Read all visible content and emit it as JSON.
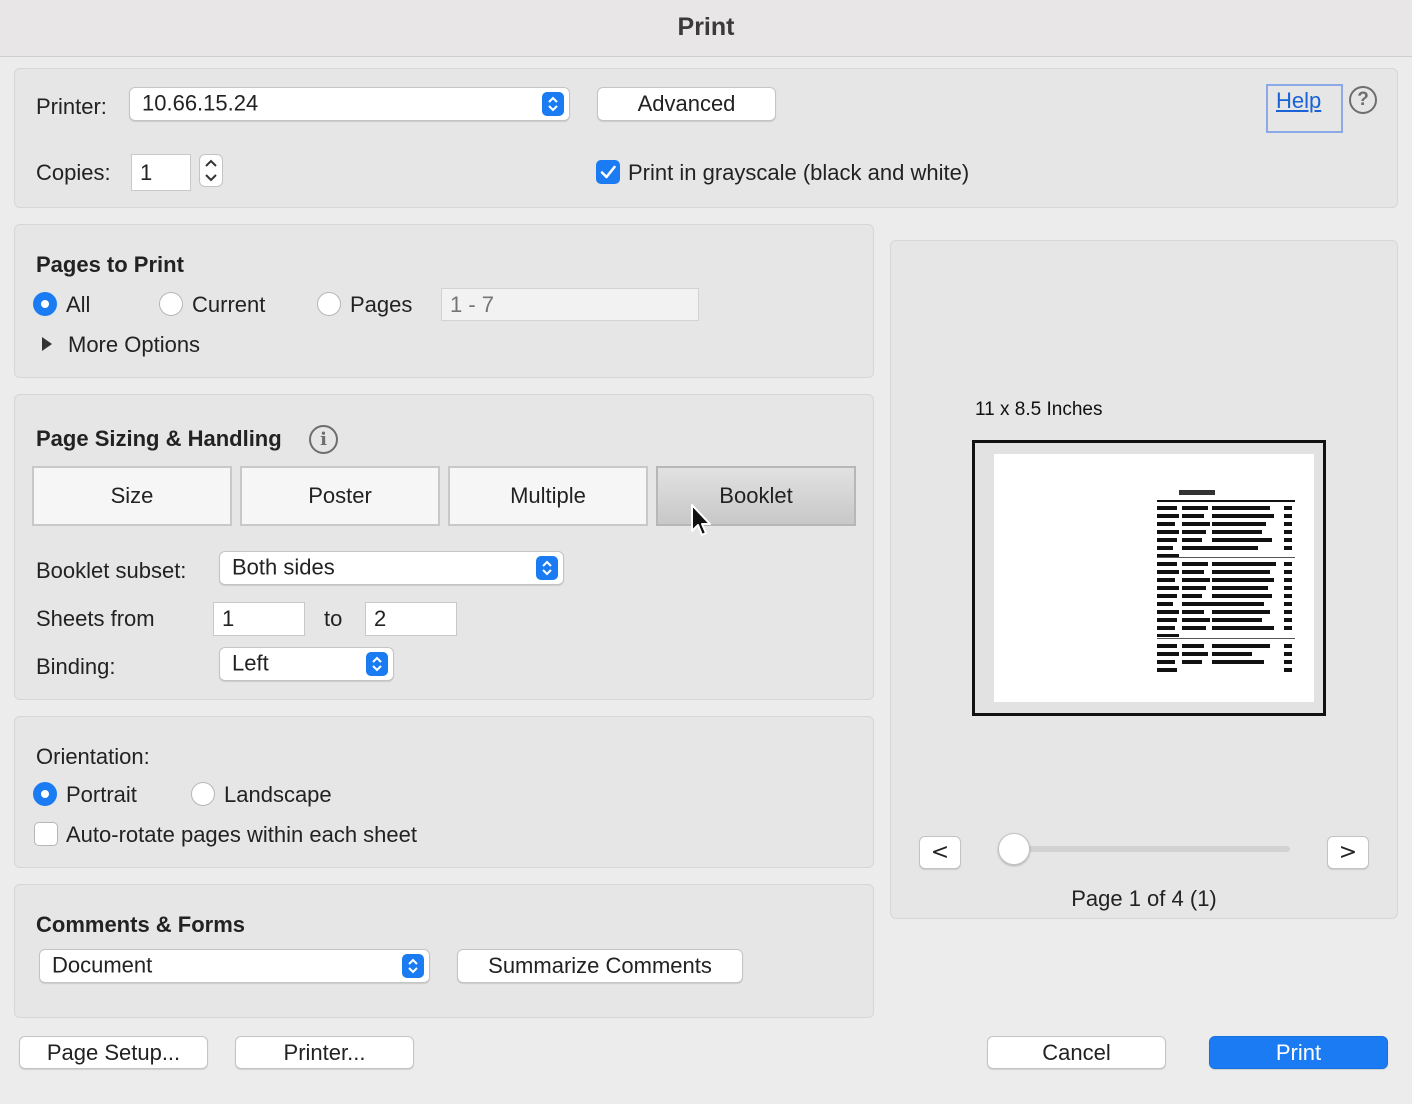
{
  "window": {
    "title": "Print"
  },
  "printer": {
    "label": "Printer:",
    "value": "10.66.15.24",
    "advanced_label": "Advanced",
    "help_label": "Help",
    "help_icon_glyph": "?"
  },
  "copies": {
    "label": "Copies:",
    "value": "1",
    "grayscale_label": "Print in grayscale (black and white)",
    "grayscale_checked": true
  },
  "pages_to_print": {
    "title": "Pages to Print",
    "options": [
      "All",
      "Current",
      "Pages"
    ],
    "selected": "All",
    "pages_placeholder": "1 - 7",
    "more_options_label": "More Options"
  },
  "page_sizing": {
    "title": "Page Sizing & Handling",
    "info_icon_glyph": "i",
    "tabs": [
      "Size",
      "Poster",
      "Multiple",
      "Booklet"
    ],
    "active_tab": "Booklet",
    "booklet_subset_label": "Booklet subset:",
    "booklet_subset_value": "Both sides",
    "sheets_from_label": "Sheets from",
    "sheets_from_value": "1",
    "sheets_to_label": "to",
    "sheets_to_value": "2",
    "binding_label": "Binding:",
    "binding_value": "Left"
  },
  "orientation": {
    "title": "Orientation:",
    "options": [
      "Portrait",
      "Landscape"
    ],
    "selected": "Portrait",
    "auto_rotate_label": "Auto-rotate pages within each sheet",
    "auto_rotate_checked": false
  },
  "comments_forms": {
    "title": "Comments & Forms",
    "value": "Document",
    "summarize_label": "Summarize Comments"
  },
  "preview": {
    "size_label": "11 x 8.5 Inches",
    "prev_label": "<",
    "next_label": ">",
    "page_indicator": "Page 1 of 4 (1)",
    "slider_position": 0
  },
  "footer": {
    "page_setup_label": "Page Setup...",
    "printer_label": "Printer...",
    "cancel_label": "Cancel",
    "print_label": "Print"
  },
  "colors": {
    "accent": "#1a7bf2",
    "panel_bg": "#e6e6e6",
    "window_bg": "#ececec"
  }
}
